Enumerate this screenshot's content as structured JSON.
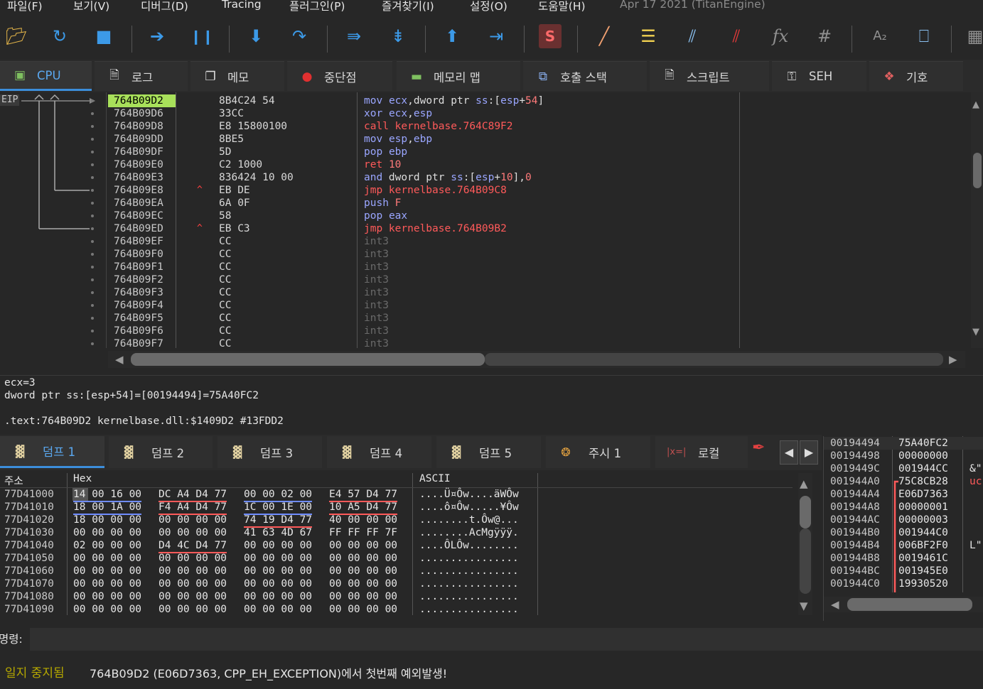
{
  "menu": {
    "items": [
      "파일(F)",
      "보기(V)",
      "디버그(D)",
      "Tracing",
      "플러그인(P)",
      "즐겨찾기(I)",
      "설정(O)",
      "도움말(H)"
    ],
    "title": "Apr 17 2021 (TitanEngine)"
  },
  "toolbar": {
    "icons": [
      "open-icon",
      "restart-icon",
      "stop-icon",
      "run-icon",
      "pause-icon",
      "step-into-icon",
      "step-over-icon",
      "trace-into-icon",
      "trace-over-icon",
      "execute-till-return-icon",
      "run-to-user-code-icon",
      "scylla-icon",
      "patch-icon",
      "comments-icon",
      "labels-icon",
      "bookmarks-icon",
      "functions-icon",
      "hash-icon",
      "strings-icon",
      "calculator-icon",
      "memory-icon"
    ]
  },
  "cpu_tabs": [
    {
      "label": "CPU",
      "icon": "cpu-icon"
    },
    {
      "label": "로그",
      "icon": "log-icon"
    },
    {
      "label": "메모",
      "icon": "notes-icon"
    },
    {
      "label": "중단점",
      "icon": "breakpoint-icon"
    },
    {
      "label": "메모리 맵",
      "icon": "memory-map-icon"
    },
    {
      "label": "호출 스택",
      "icon": "call-stack-icon"
    },
    {
      "label": "스크립트",
      "icon": "script-icon"
    },
    {
      "label": "SEH",
      "icon": "seh-icon"
    },
    {
      "label": "기호",
      "icon": "symbols-icon"
    }
  ],
  "eip_label": "EIP",
  "disasm": [
    {
      "addr": "764B09D2",
      "bytes": "8B4C24 54",
      "mark": "",
      "asm": [
        [
          "mov",
          "kw-mov"
        ],
        [
          " ",
          "plain"
        ],
        [
          "ecx",
          "reg"
        ],
        [
          ",dword ptr ",
          "plain"
        ],
        [
          "ss",
          "reg"
        ],
        [
          ":[",
          "plain"
        ],
        [
          "esp",
          "reg"
        ],
        [
          "+",
          "plain"
        ],
        [
          "54",
          "num"
        ],
        [
          "]",
          "plain"
        ]
      ]
    },
    {
      "addr": "764B09D6",
      "bytes": "33CC",
      "mark": "",
      "asm": [
        [
          "xor",
          "kw-mov"
        ],
        [
          " ",
          "plain"
        ],
        [
          "ecx",
          "reg"
        ],
        [
          ",",
          "plain"
        ],
        [
          "esp",
          "reg"
        ]
      ]
    },
    {
      "addr": "764B09D8",
      "bytes": "E8 15800100",
      "mark": "",
      "asm": [
        [
          "call",
          "kw-jmp"
        ],
        [
          " kernelbase.764C89F2",
          "kw-jmp"
        ]
      ]
    },
    {
      "addr": "764B09DD",
      "bytes": "8BE5",
      "mark": "",
      "asm": [
        [
          "mov",
          "kw-mov"
        ],
        [
          " ",
          "plain"
        ],
        [
          "esp",
          "reg"
        ],
        [
          ",",
          "plain"
        ],
        [
          "ebp",
          "reg"
        ]
      ]
    },
    {
      "addr": "764B09DF",
      "bytes": "5D",
      "mark": "",
      "asm": [
        [
          "pop",
          "kw-mov"
        ],
        [
          " ",
          "plain"
        ],
        [
          "ebp",
          "reg"
        ]
      ]
    },
    {
      "addr": "764B09E0",
      "bytes": "C2 1000",
      "mark": "",
      "asm": [
        [
          "ret",
          "kw-ret"
        ],
        [
          " ",
          "plain"
        ],
        [
          "10",
          "num"
        ]
      ]
    },
    {
      "addr": "764B09E3",
      "bytes": "836424 10 00",
      "mark": "",
      "asm": [
        [
          "and",
          "kw-mov"
        ],
        [
          " dword ptr ",
          "plain"
        ],
        [
          "ss",
          "reg"
        ],
        [
          ":[",
          "plain"
        ],
        [
          "esp",
          "reg"
        ],
        [
          "+",
          "plain"
        ],
        [
          "10",
          "num"
        ],
        [
          "],",
          "plain"
        ],
        [
          "0",
          "num"
        ]
      ]
    },
    {
      "addr": "764B09E8",
      "bytes": "EB DE",
      "mark": "^",
      "asm": [
        [
          "jmp",
          "kw-jmp"
        ],
        [
          " kernelbase.764B09C8",
          "kw-jmp"
        ]
      ]
    },
    {
      "addr": "764B09EA",
      "bytes": "6A 0F",
      "mark": "",
      "asm": [
        [
          "push",
          "kw-mov"
        ],
        [
          " ",
          "plain"
        ],
        [
          "F",
          "num"
        ]
      ]
    },
    {
      "addr": "764B09EC",
      "bytes": "58",
      "mark": "",
      "asm": [
        [
          "pop",
          "kw-mov"
        ],
        [
          " ",
          "plain"
        ],
        [
          "eax",
          "reg"
        ]
      ]
    },
    {
      "addr": "764B09ED",
      "bytes": "EB C3",
      "mark": "^",
      "asm": [
        [
          "jmp",
          "kw-jmp"
        ],
        [
          " kernelbase.764B09B2",
          "kw-jmp"
        ]
      ]
    },
    {
      "addr": "764B09EF",
      "bytes": "CC",
      "mark": "",
      "asm": [
        [
          "int3",
          "kw-int"
        ]
      ]
    },
    {
      "addr": "764B09F0",
      "bytes": "CC",
      "mark": "",
      "asm": [
        [
          "int3",
          "kw-int"
        ]
      ]
    },
    {
      "addr": "764B09F1",
      "bytes": "CC",
      "mark": "",
      "asm": [
        [
          "int3",
          "kw-int"
        ]
      ]
    },
    {
      "addr": "764B09F2",
      "bytes": "CC",
      "mark": "",
      "asm": [
        [
          "int3",
          "kw-int"
        ]
      ]
    },
    {
      "addr": "764B09F3",
      "bytes": "CC",
      "mark": "",
      "asm": [
        [
          "int3",
          "kw-int"
        ]
      ]
    },
    {
      "addr": "764B09F4",
      "bytes": "CC",
      "mark": "",
      "asm": [
        [
          "int3",
          "kw-int"
        ]
      ]
    },
    {
      "addr": "764B09F5",
      "bytes": "CC",
      "mark": "",
      "asm": [
        [
          "int3",
          "kw-int"
        ]
      ]
    },
    {
      "addr": "764B09F6",
      "bytes": "CC",
      "mark": "",
      "asm": [
        [
          "int3",
          "kw-int"
        ]
      ]
    },
    {
      "addr": "764B09F7",
      "bytes": "CC",
      "mark": "",
      "asm": [
        [
          "int3",
          "kw-int"
        ]
      ]
    }
  ],
  "info": {
    "line1": "ecx=3",
    "line2": "dword ptr ss:[esp+54]=[00194494]=75A40FC2",
    "line3": ".text:764B09D2 kernelbase.dll:$1409D2 #13FDD2"
  },
  "dump_tabs": [
    {
      "label": "덤프 1"
    },
    {
      "label": "덤프 2"
    },
    {
      "label": "덤프 3"
    },
    {
      "label": "덤프 4"
    },
    {
      "label": "덤프 5"
    },
    {
      "label": "주시 1"
    },
    {
      "label": "로컬"
    }
  ],
  "dump_headers": {
    "addr": "주소",
    "hex": "Hex",
    "ascii": "ASCII"
  },
  "dump": [
    {
      "addr": "77D41000",
      "hex": [
        "14 00 16 00",
        "DC A4 D4 77",
        "00 00 02 00",
        "E4 57 D4 77"
      ],
      "ul": [
        "blue",
        "red",
        "blue",
        "red"
      ],
      "ascii": "....Ü¤Ôw....äWÔw"
    },
    {
      "addr": "77D41010",
      "hex": [
        "18 00 1A 00",
        "F4 A4 D4 77",
        "1C 00 1E 00",
        "10 A5 D4 77"
      ],
      "ul": [
        "blue",
        "red",
        "blue",
        "red"
      ],
      "ascii": "....ô¤Ôw.....¥Ôw"
    },
    {
      "addr": "77D41020",
      "hex": [
        "18 00 00 00",
        "00 00 00 00",
        "74 19 D4 77",
        "40 00 00 00"
      ],
      "ul": [
        "",
        "",
        "red",
        ""
      ],
      "ascii": "........t.Ôw@..."
    },
    {
      "addr": "77D41030",
      "hex": [
        "00 00 00 00",
        "00 00 00 00",
        "41 63 4D 67",
        "FF FF FF 7F"
      ],
      "ul": [
        "",
        "",
        "",
        ""
      ],
      "ascii": "........AcMgÿÿÿ."
    },
    {
      "addr": "77D41040",
      "hex": [
        "02 00 00 00",
        "D4 4C D4 77",
        "00 00 00 00",
        "00 00 00 00"
      ],
      "ul": [
        "",
        "red",
        "",
        ""
      ],
      "ascii": "....ÔLÔw........"
    },
    {
      "addr": "77D41050",
      "hex": [
        "00 00 00 00",
        "00 00 00 00",
        "00 00 00 00",
        "00 00 00 00"
      ],
      "ul": [
        "",
        "",
        "",
        ""
      ],
      "ascii": "................"
    },
    {
      "addr": "77D41060",
      "hex": [
        "00 00 00 00",
        "00 00 00 00",
        "00 00 00 00",
        "00 00 00 00"
      ],
      "ul": [
        "",
        "",
        "",
        ""
      ],
      "ascii": "................"
    },
    {
      "addr": "77D41070",
      "hex": [
        "00 00 00 00",
        "00 00 00 00",
        "00 00 00 00",
        "00 00 00 00"
      ],
      "ul": [
        "",
        "",
        "",
        ""
      ],
      "ascii": "................"
    },
    {
      "addr": "77D41080",
      "hex": [
        "00 00 00 00",
        "00 00 00 00",
        "00 00 00 00",
        "00 00 00 00"
      ],
      "ul": [
        "",
        "",
        "",
        ""
      ],
      "ascii": "................"
    },
    {
      "addr": "77D41090",
      "hex": [
        "00 00 00 00",
        "00 00 00 00",
        "00 00 00 00",
        "00 00 00 00"
      ],
      "ul": [
        "",
        "",
        "",
        ""
      ],
      "ascii": "................"
    }
  ],
  "stack": [
    {
      "addr": "00194494",
      "val": "75A40FC2",
      "cmt": ""
    },
    {
      "addr": "00194498",
      "val": "00000000",
      "cmt": ""
    },
    {
      "addr": "0019449C",
      "val": "001944CC",
      "cmt": "&\""
    },
    {
      "addr": "001944A0",
      "val": "75C8CB28",
      "cmt": "uc"
    },
    {
      "addr": "001944A4",
      "val": "E06D7363",
      "cmt": ""
    },
    {
      "addr": "001944A8",
      "val": "00000001",
      "cmt": ""
    },
    {
      "addr": "001944AC",
      "val": "00000003",
      "cmt": ""
    },
    {
      "addr": "001944B0",
      "val": "001944C0",
      "cmt": ""
    },
    {
      "addr": "001944B4",
      "val": "006BF2F0",
      "cmt": "L\""
    },
    {
      "addr": "001944B8",
      "val": "0019461C",
      "cmt": ""
    },
    {
      "addr": "001944BC",
      "val": "001945E0",
      "cmt": ""
    },
    {
      "addr": "001944C0",
      "val": "19930520",
      "cmt": ""
    }
  ],
  "command": {
    "label": "명령:",
    "value": ""
  },
  "status": {
    "state": "일지 중지됨",
    "message": "764B09D2 (E06D7363, CPP_EH_EXCEPTION)에서 첫번째 예외발생!"
  },
  "colors": {
    "accent": "#3c8edb",
    "selected": "#a8e05a",
    "jump": "#ff5a5a",
    "register": "#9aa6ff",
    "paused": "#b6a800"
  }
}
